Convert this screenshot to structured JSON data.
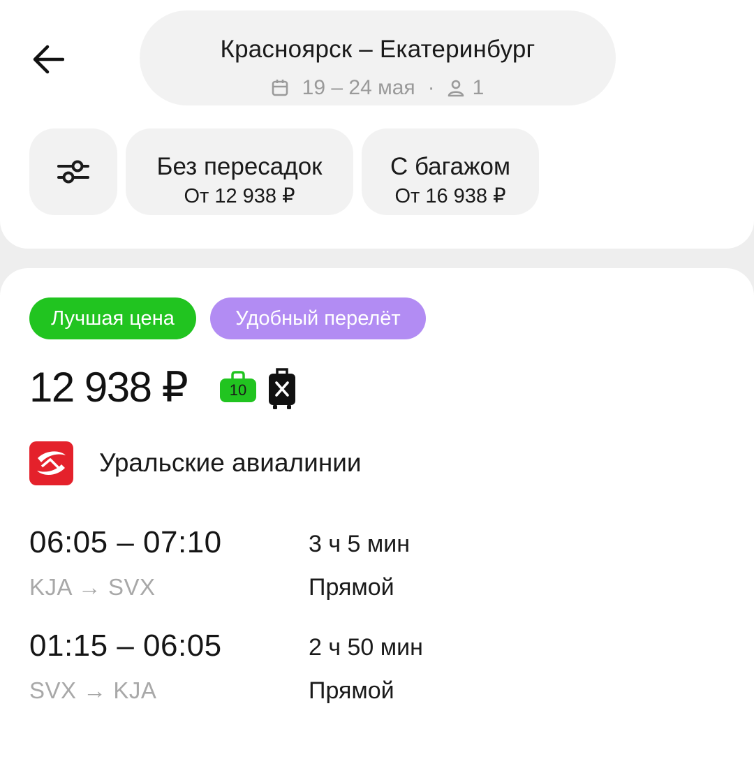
{
  "header": {
    "route_title": "Красноярск – Екатеринбург",
    "dates": "19 – 24 мая",
    "separator": "·",
    "passengers": "1"
  },
  "filters": {
    "nonstop": {
      "title": "Без пересадок",
      "price": "От 12 938 ₽"
    },
    "baggage": {
      "title": "С багажом",
      "price": "От 16 938 ₽"
    }
  },
  "offer": {
    "badges": [
      "Лучшая цена",
      "Удобный перелёт"
    ],
    "price": "12 938 ₽",
    "hand_luggage_kg": "10",
    "airline": "Уральские авиалинии",
    "flights": [
      {
        "times": "06:05 – 07:10",
        "route": "KJA → SVX",
        "duration": "3 ч 5 мин",
        "type": "Прямой"
      },
      {
        "times": "01:15 – 06:05",
        "route": "SVX → KJA",
        "duration": "2 ч 50 мин",
        "type": "Прямой"
      }
    ]
  },
  "colors": {
    "best_badge": "#21c420",
    "convenient_badge": "#b28cf3",
    "airline_brand": "#e4212b"
  },
  "icons": [
    "back-arrow-icon",
    "calendar-icon",
    "person-icon",
    "filter-sliders-icon",
    "hand-luggage-icon",
    "no-baggage-suitcase-icon"
  ]
}
